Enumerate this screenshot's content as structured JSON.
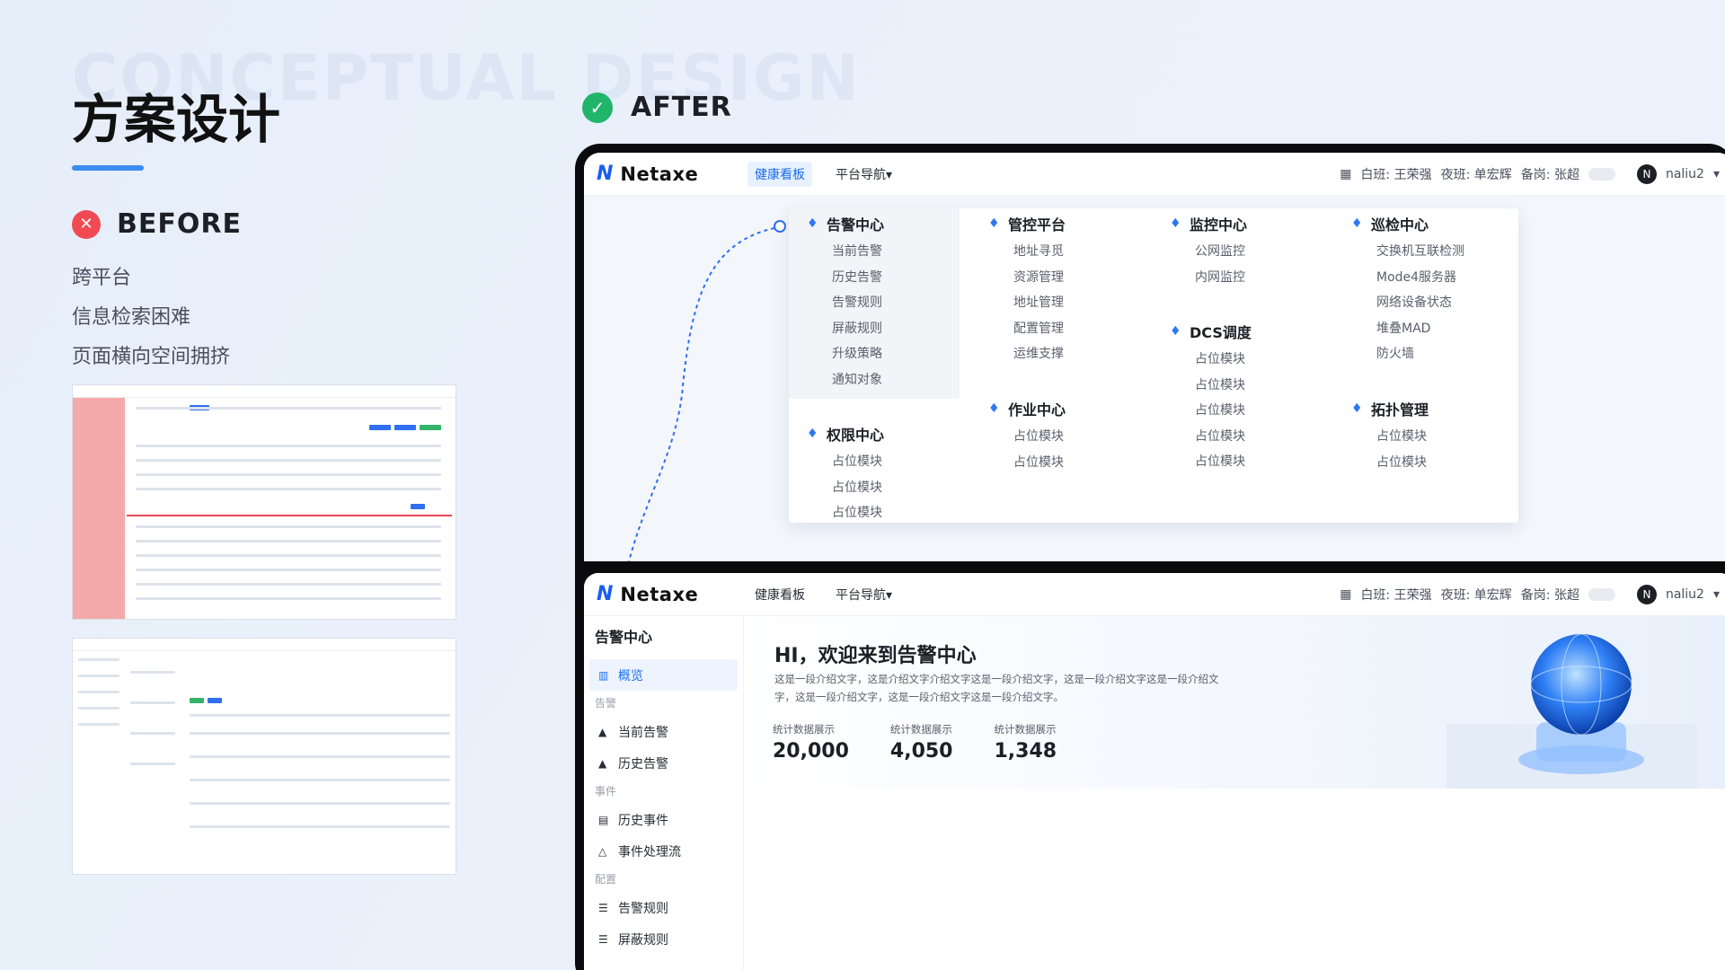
{
  "slide": {
    "title": "方案设计",
    "watermark": "CONCEPTUAL DESIGN",
    "before_label": "BEFORE",
    "after_label": "AFTER",
    "before_points": [
      "跨平台",
      "信息检索困难",
      "页面横向空间拥挤"
    ],
    "colors": {
      "accent": "#3a8cf0",
      "before": "#f04b55",
      "after": "#21b56a"
    }
  },
  "app": {
    "brand": "Netaxe",
    "nav": [
      "健康看板",
      "平台导航"
    ],
    "shift": {
      "day": "白班: 王荣强",
      "night": "夜班: 单宏辉",
      "standby": "备岗: 张超"
    },
    "user": {
      "initial": "N",
      "name": "naliu2"
    }
  },
  "mega_menu": {
    "columns": [
      {
        "groups": [
          {
            "title": "告警中心",
            "items": [
              "当前告警",
              "历史告警",
              "告警规则",
              "屏蔽规则",
              "升级策略",
              "通知对象"
            ]
          },
          {
            "title": "权限中心",
            "items": [
              "占位模块",
              "占位模块",
              "占位模块"
            ]
          }
        ]
      },
      {
        "groups": [
          {
            "title": "管控平台",
            "items": [
              "地址寻觅",
              "资源管理",
              "地址管理",
              "配置管理",
              "运维支撑"
            ]
          },
          {
            "title": "作业中心",
            "items": [
              "占位模块",
              "占位模块"
            ]
          }
        ]
      },
      {
        "groups": [
          {
            "title": "监控中心",
            "items": [
              "公网监控",
              "内网监控"
            ]
          },
          {
            "title": "DCS调度",
            "items": [
              "占位模块",
              "占位模块",
              "占位模块",
              "占位模块",
              "占位模块"
            ]
          }
        ]
      },
      {
        "groups": [
          {
            "title": "巡检中心",
            "items": [
              "交换机互联检测",
              "Mode4服务器",
              "网络设备状态",
              "堆叠MAD",
              "防火墙"
            ]
          },
          {
            "title": "拓扑管理",
            "items": [
              "占位模块",
              "占位模块"
            ]
          }
        ]
      }
    ]
  },
  "alarm_page": {
    "sidebar_title": "告警中心",
    "active_item": "概览",
    "sections": [
      {
        "label": "告警",
        "items": [
          "当前告警",
          "历史告警"
        ]
      },
      {
        "label": "事件",
        "items": [
          "历史事件",
          "事件处理流"
        ]
      },
      {
        "label": "配置",
        "items": [
          "告警规则",
          "屏蔽规则"
        ]
      }
    ],
    "hero_title": "HI，欢迎来到告警中心",
    "hero_desc": "这是一段介绍文字，这是介绍文字介绍文字这是一段介绍文字，这是一段介绍文字这是一段介绍文字，这是一段介绍文字，这是一段介绍文字这是一段介绍文字。",
    "stats": [
      {
        "label": "统计数据展示",
        "value": "20,000"
      },
      {
        "label": "统计数据展示",
        "value": "4,050"
      },
      {
        "label": "统计数据展示",
        "value": "1,348"
      }
    ]
  }
}
